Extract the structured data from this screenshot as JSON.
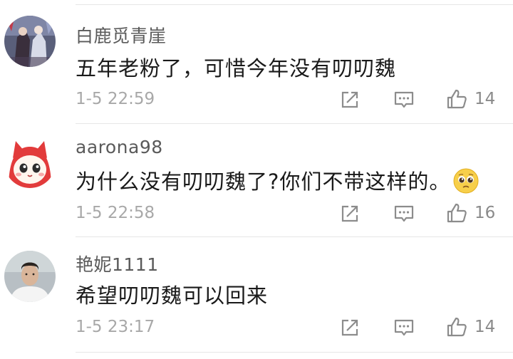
{
  "comments": [
    {
      "username": "白鹿觅青崖",
      "text": "五年老粉了，可惜今年没有叨叨魏",
      "timestamp": "1-5 22:59",
      "likes": "14"
    },
    {
      "username": "aarona98",
      "text": "为什么没有叨叨魏了?你们不带这样的。",
      "emoji": "pleading-face-emoji",
      "timestamp": "1-5 22:58",
      "likes": "16"
    },
    {
      "username": "艳妮1111",
      "text": "希望叨叨魏可以回来",
      "timestamp": "1-5 23:17",
      "likes": "14"
    }
  ],
  "icons": {
    "share": "share-icon",
    "reply": "reply-comment-icon",
    "like": "thumbs-up-icon"
  },
  "colors": {
    "username": "#5a5a5a",
    "text": "#1a1a1a",
    "meta": "#a8a8a8",
    "icon": "#8c8c8c",
    "divider": "#e6e6e6"
  }
}
